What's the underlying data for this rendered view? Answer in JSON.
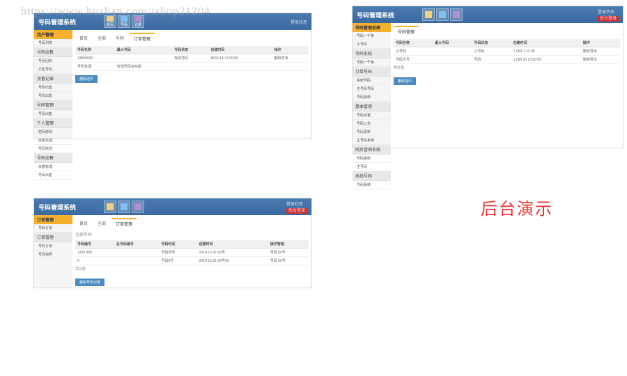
{
  "watermark": "https://www.huzhan.com/ishop21204",
  "big_label": "后台演示",
  "app_title": "号码管理系统",
  "nav": [
    "首页",
    "号码",
    "记录"
  ],
  "user_area": "登录状态",
  "admin_badge": "后台登录",
  "panel1": {
    "sb_head": "用户管理",
    "cats": [
      "号码出售",
      "充值记录",
      "号码管理",
      "个人管理",
      "号码出售"
    ],
    "items": [
      "号码列表",
      "号码回收",
      "已售号码",
      "号码出售",
      "密码修改",
      "余额充值",
      "号码修改",
      "余额管理",
      "号码出售"
    ],
    "tabs": [
      "首页",
      "全部",
      "号码",
      "订单管理"
    ],
    "cols": [
      "号码名称",
      "最大号码",
      "号码状态",
      "创建时间",
      "操作"
    ],
    "rows": [
      [
        "13800000",
        "有效号码",
        "8000-13-13 00:00",
        "删除导出"
      ],
      [
        "号码管理",
        "管理号码有效期",
        "",
        ""
      ]
    ],
    "btn": "删除选中"
  },
  "panel2": {
    "sb_head": "号码管理系统",
    "cats": [
      "号码系统",
      "订单号码",
      "基本管理",
      "网页营销系统",
      "系统号码"
    ],
    "items": [
      "号码一千条",
      "小号码",
      "号码一千条",
      "系统号码",
      "主号码号码",
      "号码系统",
      "号码设置",
      "号码公告",
      "号码更新",
      "主号码系统",
      "号码系统",
      "主号码",
      "号码系统"
    ],
    "tabs": [
      "号码管理"
    ],
    "cols": [
      "号码名称",
      "最大号码",
      "号码状态",
      "创建时间",
      "操作"
    ],
    "rows": [
      [
        "小号码",
        "小号码",
        "1.000-1.13 00",
        "删除导出"
      ],
      [
        "号码大号",
        "号码",
        "1.000 00 13 00:00",
        "删除导出"
      ]
    ],
    "btn": "删除选中"
  },
  "panel3": {
    "sb_head": "订单管理",
    "cats": [
      "订单管理"
    ],
    "items": [
      "号码订单",
      "号码快照"
    ],
    "tabs": [
      "首页",
      "全部",
      "订单管理"
    ],
    "toolbar": "全部号码",
    "cols": [
      "号码编号",
      "总号码编号",
      "号码时间",
      "创建时间",
      "操作管理"
    ],
    "rows": [
      [
        "1200 300",
        "号码母号",
        "2018-13-21 00号",
        "号码 00号"
      ],
      [
        "0",
        "号码3号",
        "2018-13-21 00号00",
        "号码 00号"
      ]
    ],
    "btn": "删除号码记录"
  }
}
